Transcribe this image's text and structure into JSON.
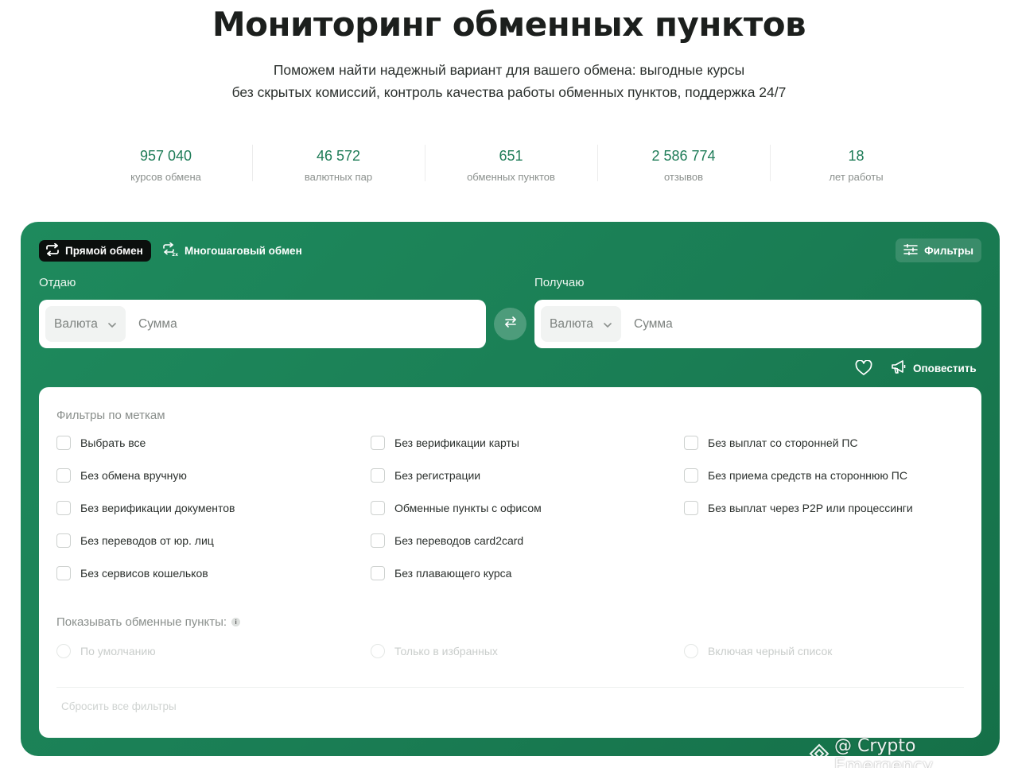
{
  "header": {
    "title": "Мониторинг обменных пунктов",
    "subtitle_line1": "Поможем найти надежный вариант для вашего обмена: выгодные курсы",
    "subtitle_line2": "без скрытых комиссий, контроль качества работы обменных пунктов, поддержка 24/7"
  },
  "stats": [
    {
      "value": "957 040",
      "label": "курсов обмена"
    },
    {
      "value": "46 572",
      "label": "валютных пар"
    },
    {
      "value": "651",
      "label": "обменных пунктов"
    },
    {
      "value": "2 586 774",
      "label": "отзывов"
    },
    {
      "value": "18",
      "label": "лет работы"
    }
  ],
  "exchange": {
    "tabs": {
      "direct": "Прямой обмен",
      "multistep": "Многошаговый обмен"
    },
    "filters_button": "Фильтры",
    "give": {
      "label": "Отдаю",
      "currency": "Валюта",
      "amount_placeholder": "Сумма"
    },
    "get": {
      "label": "Получаю",
      "currency": "Валюта",
      "amount_placeholder": "Сумма"
    },
    "notify_button": "Оповестить"
  },
  "filters": {
    "heading": "Фильтры по меткам",
    "columns": [
      [
        "Выбрать все",
        "Без обмена вручную",
        "Без верификации документов",
        "Без переводов от юр. лиц",
        "Без сервисов кошельков"
      ],
      [
        "Без верификации карты",
        "Без регистрации",
        "Обменные пункты с офисом",
        "Без переводов card2card",
        "Без плавающего курса"
      ],
      [
        "Без выплат со сторонней ПС",
        "Без приема средств на стороннюю ПС",
        "Без выплат через P2P или процессинги"
      ]
    ],
    "show_label": "Показывать обменные пункты:",
    "show_options": [
      "По умолчанию",
      "Только в избранных",
      "Включая черный список"
    ],
    "reset": "Сбросить все фильтры"
  },
  "watermark": {
    "text": "@ Crypto Emergency"
  },
  "colors": {
    "accent": "#1a7d54",
    "stat_value": "#1f7c58",
    "tab_active_bg": "#0b0f0d"
  }
}
